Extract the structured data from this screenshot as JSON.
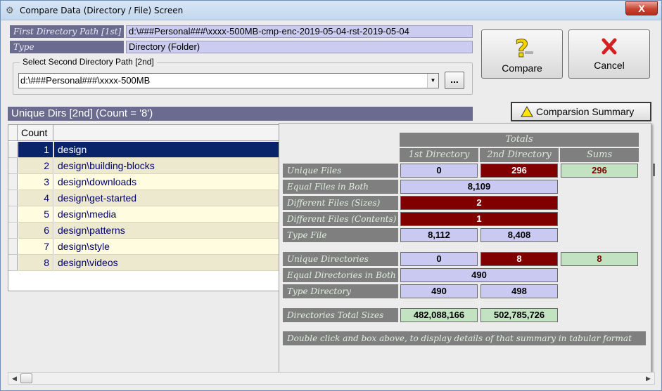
{
  "window": {
    "title": "Compare Data (Directory / File) Screen",
    "close_label": "X"
  },
  "first_path": {
    "label": "First Directory Path [1st]",
    "value": "d:\\###Personal###\\xxxx-500MB-cmp-enc-2019-05-04-rst-2019-05-04"
  },
  "type_row": {
    "label": "Type",
    "value": "Directory (Folder)"
  },
  "second_path": {
    "legend": "Select Second Directory Path  [2nd]",
    "value": "d:\\###Personal###\\xxxx-500MB",
    "browse_label": "..."
  },
  "buttons": {
    "compare": "Compare",
    "cancel": "Cancel",
    "summary": "Comparsion Summary"
  },
  "unique_dirs": {
    "header": "Unique Dirs [2nd] (Count = '8')",
    "column_count": "Count",
    "rows": [
      {
        "num": "1",
        "dir": "design"
      },
      {
        "num": "2",
        "dir": "design\\building-blocks"
      },
      {
        "num": "3",
        "dir": "design\\downloads"
      },
      {
        "num": "4",
        "dir": "design\\get-started"
      },
      {
        "num": "5",
        "dir": "design\\media"
      },
      {
        "num": "6",
        "dir": "design\\patterns"
      },
      {
        "num": "7",
        "dir": "design\\style"
      },
      {
        "num": "8",
        "dir": "design\\videos"
      }
    ],
    "selected_index": 0
  },
  "summary": {
    "totals_header": "Totals",
    "col_first": "1st Directory",
    "col_second": "2nd Directory",
    "col_sums": "Sums",
    "unique_files": {
      "label": "Unique Files",
      "first": "0",
      "second": "296",
      "sums": "296"
    },
    "equal_files": {
      "label": "Equal Files in Both",
      "value": "8,109"
    },
    "diff_sizes": {
      "label": "Different Files (Sizes)",
      "value": "2"
    },
    "diff_contents": {
      "label": "Different Files (Contents)",
      "value": "1"
    },
    "type_file": {
      "label": "Type File",
      "first": "8,112",
      "second": "8,408"
    },
    "unique_dirs": {
      "label": "Unique Directories",
      "first": "0",
      "second": "8",
      "sums": "8"
    },
    "equal_dirs": {
      "label": "Equal Directories in Both",
      "value": "490"
    },
    "type_dir": {
      "label": "Type Directory",
      "first": "490",
      "second": "498"
    },
    "dir_sizes": {
      "label": "Directories Total Sizes",
      "first": "482,088,166",
      "second": "502,785,726"
    },
    "footer_note": "Double click and box above, to display details of that summary in tabular format"
  },
  "colors": {
    "label_purple": "#6b6b8f",
    "value_lavender": "#ccccf0",
    "dark_red": "#800000",
    "light_green": "#c2e2c2",
    "selection_navy": "#0a246a"
  }
}
